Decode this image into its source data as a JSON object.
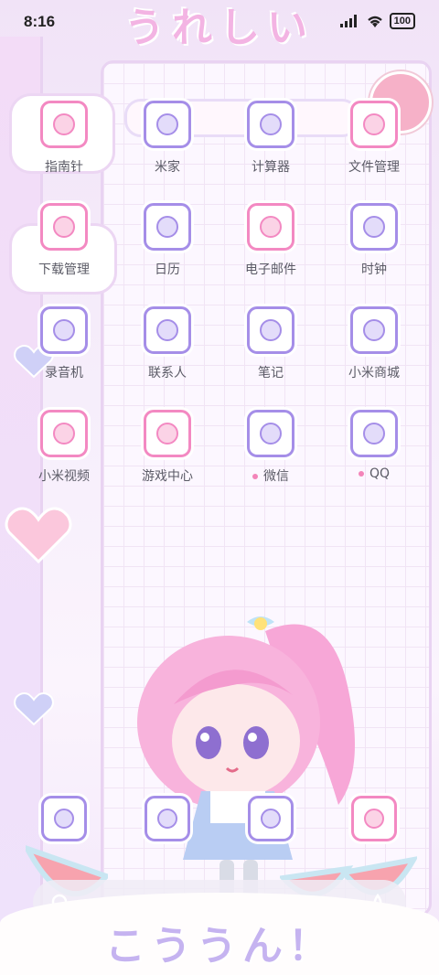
{
  "status_bar": {
    "time": "8:16",
    "battery": "100"
  },
  "wallpaper": {
    "title_top": "うれしい",
    "title_bottom": "こううん！"
  },
  "apps": [
    {
      "label": "指南针",
      "icon": "compass-icon",
      "border": "pink",
      "dot": false
    },
    {
      "label": "米家",
      "icon": "house-icon",
      "border": "purple",
      "dot": false
    },
    {
      "label": "计算器",
      "icon": "calculator-icon",
      "border": "purple",
      "dot": false
    },
    {
      "label": "文件管理",
      "icon": "folder-icon",
      "border": "pink",
      "dot": false
    },
    {
      "label": "下载管理",
      "icon": "download-arrow-icon",
      "border": "pink",
      "dot": false
    },
    {
      "label": "日历",
      "icon": "calendar-icon",
      "border": "purple",
      "dot": false
    },
    {
      "label": "电子邮件",
      "icon": "mail-icon",
      "border": "pink",
      "dot": false
    },
    {
      "label": "时钟",
      "icon": "alarm-clock-icon",
      "border": "purple",
      "dot": false
    },
    {
      "label": "录音机",
      "icon": "recorder-icon",
      "border": "purple",
      "dot": false
    },
    {
      "label": "联系人",
      "icon": "contacts-icon",
      "border": "purple",
      "dot": false
    },
    {
      "label": "笔记",
      "icon": "notes-icon",
      "border": "purple",
      "dot": false
    },
    {
      "label": "小米商城",
      "icon": "shopping-basket-icon",
      "border": "purple",
      "dot": false
    },
    {
      "label": "小米视频",
      "icon": "video-bear-icon",
      "border": "pink",
      "dot": false
    },
    {
      "label": "游戏中心",
      "icon": "game-center-icon",
      "border": "pink",
      "dot": false
    },
    {
      "label": "微信",
      "icon": "wechat-bunny-icon",
      "border": "purple",
      "dot": true
    },
    {
      "label": "QQ",
      "icon": "qq-icon",
      "border": "purple",
      "dot": true
    }
  ],
  "dock": [
    {
      "icon": "phone-icon",
      "border": "purple"
    },
    {
      "icon": "messages-flower-icon",
      "border": "purple"
    },
    {
      "icon": "camera-bear-icon",
      "border": "purple"
    },
    {
      "icon": "camera-cute-icon",
      "border": "pink"
    }
  ],
  "colors": {
    "accent_pink": "#f389c2",
    "accent_purple": "#a58ee8",
    "label_text": "#5b5b66"
  }
}
